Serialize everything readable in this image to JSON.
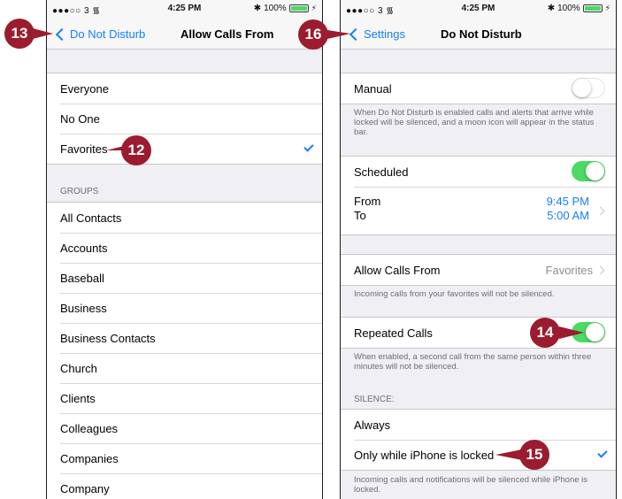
{
  "status": {
    "carrier": "●●●○○ 3 ",
    "wifi_icon": "wifi-icon",
    "time": "4:25 PM",
    "bluetooth": "✱",
    "battery": "100%",
    "battery_level": 1.0
  },
  "left": {
    "nav": {
      "back_label": "Do Not Disturb",
      "title": "Allow Calls From"
    },
    "options": [
      "Everyone",
      "No One",
      "Favorites"
    ],
    "selected": "Favorites",
    "groups_header": "GROUPS",
    "groups": [
      "All Contacts",
      "Accounts",
      "Baseball",
      "Business",
      "Business Contacts",
      "Church",
      "Clients",
      "Colleagues",
      "Companies",
      "Company"
    ]
  },
  "right": {
    "nav": {
      "back_label": "Settings",
      "title": "Do Not Disturb"
    },
    "manual": {
      "label": "Manual",
      "on": false
    },
    "manual_footer": "When Do Not Disturb is enabled calls and alerts that arrive while locked will be silenced, and a moon icon will appear in the status bar.",
    "scheduled": {
      "label": "Scheduled",
      "on": true
    },
    "schedule": {
      "from_label": "From",
      "to_label": "To",
      "from_time": "9:45 PM",
      "to_time": "5:00 AM"
    },
    "allow_calls": {
      "label": "Allow Calls From",
      "value": "Favorites"
    },
    "allow_footer": "Incoming calls from your favorites will not be silenced.",
    "repeated": {
      "label": "Repeated Calls",
      "on": true
    },
    "repeated_footer": "When enabled, a second call from the same person within three minutes will not be silenced.",
    "silence_header": "SILENCE:",
    "silence": {
      "always": "Always",
      "locked": "Only while iPhone is locked"
    },
    "silence_footer": "Incoming calls and notifications will be silenced while iPhone is locked."
  },
  "callouts": {
    "c12": "12",
    "c13": "13",
    "c14": "14",
    "c15": "15",
    "c16": "16"
  },
  "colors": {
    "accent": "#157efb",
    "toggle_on": "#4cd964",
    "callout": "#9b1c2e"
  }
}
